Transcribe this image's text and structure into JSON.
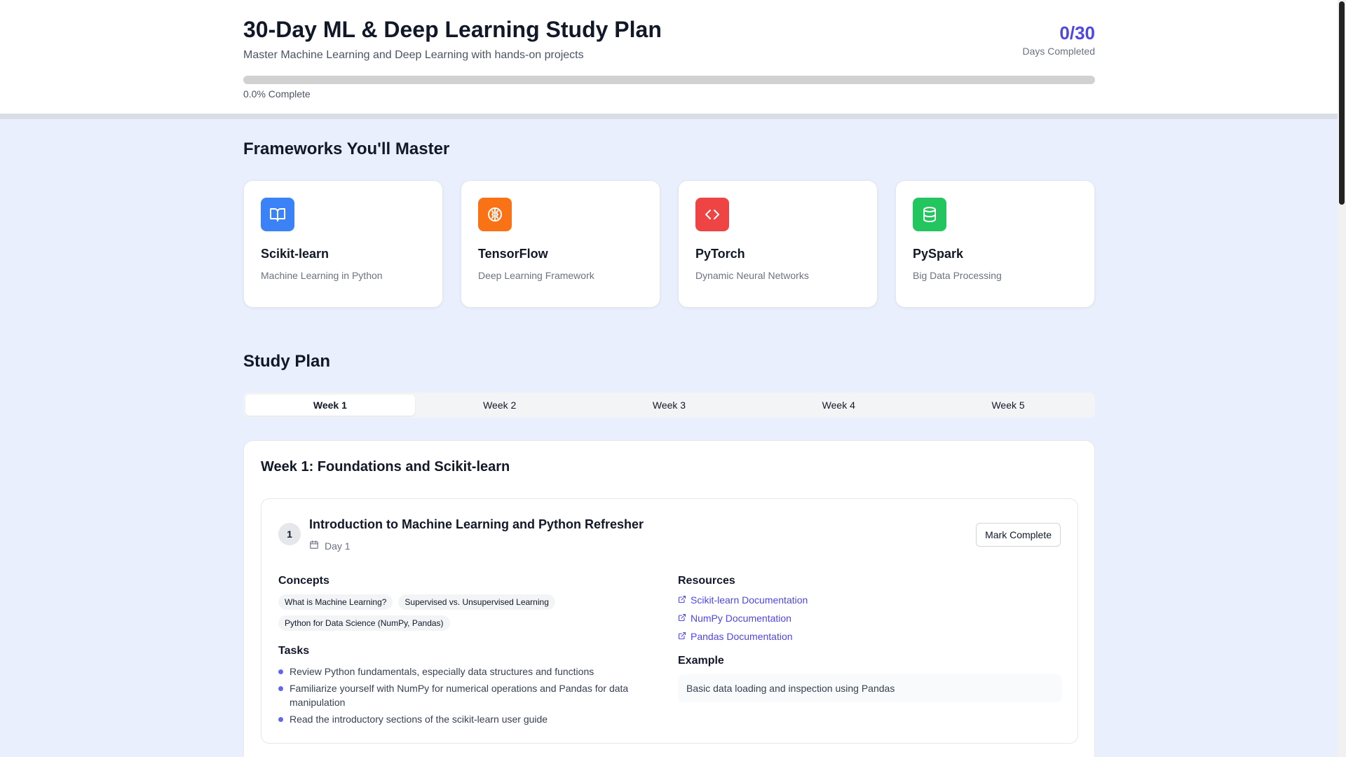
{
  "header": {
    "title": "30-Day ML & Deep Learning Study Plan",
    "subtitle": "Master Machine Learning and Deep Learning with hands-on projects",
    "days_completed": "0/30",
    "days_completed_label": "Days Completed",
    "progress_fraction": 0.0,
    "progress_label": "0.0% Complete"
  },
  "frameworks": {
    "title": "Frameworks You'll Master",
    "items": [
      {
        "name": "Scikit-learn",
        "desc": "Machine Learning in Python",
        "icon": "book-open-icon",
        "color": "#3b82f6"
      },
      {
        "name": "TensorFlow",
        "desc": "Deep Learning Framework",
        "icon": "brain-icon",
        "color": "#f97316"
      },
      {
        "name": "PyTorch",
        "desc": "Dynamic Neural Networks",
        "icon": "code-icon",
        "color": "#ef4444"
      },
      {
        "name": "PySpark",
        "desc": "Big Data Processing",
        "icon": "database-icon",
        "color": "#22c55e"
      }
    ]
  },
  "study_plan": {
    "title": "Study Plan",
    "tabs": [
      "Week 1",
      "Week 2",
      "Week 3",
      "Week 4",
      "Week 5"
    ],
    "active_tab": "Week 1"
  },
  "week": {
    "title": "Week 1: Foundations and Scikit-learn",
    "day": {
      "number": "1",
      "title": "Introduction to Machine Learning and Python Refresher",
      "label": "Day 1",
      "mark_complete": "Mark Complete",
      "concepts_title": "Concepts",
      "concepts": [
        "What is Machine Learning?",
        "Supervised vs. Unsupervised Learning",
        "Python for Data Science (NumPy, Pandas)"
      ],
      "tasks_title": "Tasks",
      "tasks": [
        "Review Python fundamentals, especially data structures and functions",
        "Familiarize yourself with NumPy for numerical operations and Pandas for data manipulation",
        "Read the introductory sections of the scikit-learn user guide"
      ],
      "resources_title": "Resources",
      "resources": [
        "Scikit-learn Documentation",
        "NumPy Documentation",
        "Pandas Documentation"
      ],
      "example_title": "Example",
      "example": "Basic data loading and inspection using Pandas"
    }
  },
  "colors": {
    "accent": "#4f46e5",
    "bullet": "#6366f1",
    "background": "#e9effc"
  }
}
